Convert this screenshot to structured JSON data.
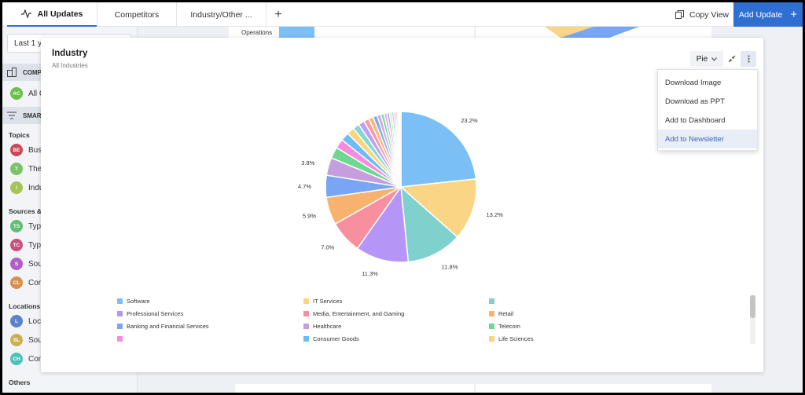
{
  "tabs": [
    {
      "label": "All Updates",
      "active": true
    },
    {
      "label": "Competitors",
      "active": false
    },
    {
      "label": "Industry/Other ...",
      "active": false
    }
  ],
  "toolbar": {
    "copy_view": "Copy View",
    "add_update": "Add Update"
  },
  "sidebar": {
    "date_range": "Last 1 y",
    "sections": [
      {
        "label": "COMPA"
      },
      {
        "label": "SMART"
      }
    ],
    "all_item": {
      "initials": "AC",
      "label": "All C",
      "color": "#6bbf4e"
    },
    "groups": [
      {
        "heading": "Topics",
        "items": [
          {
            "initials": "BE",
            "label": "Bus",
            "color": "#c94a55"
          },
          {
            "initials": "T",
            "label": "The",
            "color": "#7cc26a"
          },
          {
            "initials": "I",
            "label": "Indu",
            "color": "#a4c555"
          }
        ]
      },
      {
        "heading": "Sources &",
        "items": [
          {
            "initials": "TS",
            "label": "Type",
            "color": "#5fbf75"
          },
          {
            "initials": "TC",
            "label": "Type",
            "color": "#c8507a"
          },
          {
            "initials": "S",
            "label": "Sou",
            "color": "#b05fc4"
          },
          {
            "initials": "CL",
            "label": "Con",
            "color": "#d98f4e"
          }
        ]
      },
      {
        "heading": "Locations",
        "items": [
          {
            "initials": "L",
            "label": "Loca",
            "color": "#5c82cc"
          },
          {
            "initials": "SL",
            "label": "Sou",
            "color": "#c9b152"
          },
          {
            "initials": "CH",
            "label": "Con",
            "color": "#4fc0b6"
          }
        ]
      },
      {
        "heading": "Others",
        "items": []
      }
    ]
  },
  "background": {
    "row_label": "Operations"
  },
  "modal": {
    "title": "Industry",
    "subtitle": "All Industries",
    "chart_type_select": "Pie",
    "menu": [
      "Download Image",
      "Download as PPT",
      "Add to Dashboard",
      "Add to Newsletter"
    ],
    "hovered_menu_index": 3
  },
  "chart_data": {
    "type": "pie",
    "title": "Industry",
    "subtitle": "All Industries",
    "slices": [
      {
        "name": "Software",
        "value": 23.2,
        "label": "23.2%",
        "color": "#7bbff7"
      },
      {
        "name": "IT Services",
        "value": 13.2,
        "label": "13.2%",
        "color": "#fad585"
      },
      {
        "name": "",
        "value": 11.8,
        "label": "11.8%",
        "color": "#7fd1cd"
      },
      {
        "name": "Professional Services",
        "value": 11.3,
        "label": "11.3%",
        "color": "#b596f7"
      },
      {
        "name": "Media, Entertainment, and Gaming",
        "value": 7.0,
        "label": "7.0%",
        "color": "#f88f9e"
      },
      {
        "name": "Retail",
        "value": 5.9,
        "label": "5.9%",
        "color": "#f7b26f"
      },
      {
        "name": "Banking and Financial Services",
        "value": 4.7,
        "label": "4.7%",
        "color": "#78a6f4"
      },
      {
        "name": "Healthcare",
        "value": 3.8,
        "label": "3.8%",
        "color": "#c69ee0"
      },
      {
        "name": "Telecom",
        "value": 2.4,
        "label": "",
        "color": "#6ed88f"
      },
      {
        "name": "",
        "value": 2.0,
        "label": "",
        "color": "#f78be0"
      },
      {
        "name": "Consumer Goods",
        "value": 1.8,
        "label": "",
        "color": "#6cbdf6"
      },
      {
        "name": "Life Sciences",
        "value": 1.6,
        "label": "",
        "color": "#fbd480"
      },
      {
        "name": "",
        "value": 1.4,
        "label": "",
        "color": "#86d6d2"
      },
      {
        "name": "",
        "value": 1.3,
        "label": "",
        "color": "#bba0f4"
      },
      {
        "name": "",
        "value": 1.1,
        "label": "",
        "color": "#f59aa8"
      },
      {
        "name": "",
        "value": 1.0,
        "label": "",
        "color": "#f7b87a"
      },
      {
        "name": "",
        "value": 0.9,
        "label": "",
        "color": "#86aaf0"
      },
      {
        "name": "",
        "value": 0.8,
        "label": "",
        "color": "#cda6e6"
      },
      {
        "name": "",
        "value": 0.7,
        "label": "",
        "color": "#7ddd9d"
      },
      {
        "name": "",
        "value": 0.6,
        "label": "",
        "color": "#f39ee2"
      },
      {
        "name": "",
        "value": 0.55,
        "label": "",
        "color": "#80c4f4"
      },
      {
        "name": "",
        "value": 0.5,
        "label": "",
        "color": "#f8d78f"
      },
      {
        "name": "",
        "value": 0.45,
        "label": "",
        "color": "#8fd9d5"
      },
      {
        "name": "",
        "value": 0.4,
        "label": "",
        "color": "#c0a8f2"
      },
      {
        "name": "",
        "value": 0.35,
        "label": "",
        "color": "#f5a3b0"
      },
      {
        "name": "",
        "value": 0.3,
        "label": "",
        "color": "#f6bd85"
      },
      {
        "name": "",
        "value": 0.25,
        "label": "",
        "color": "#92b0ee"
      },
      {
        "name": "",
        "value": 0.2,
        "label": "",
        "color": "#d3aee8"
      }
    ],
    "legend": [
      {
        "name": "Software",
        "color": "#7bbff7"
      },
      {
        "name": "IT Services",
        "color": "#fad585"
      },
      {
        "name": "",
        "color": "#7fd1cd"
      },
      {
        "name": "Professional Services",
        "color": "#b596f7"
      },
      {
        "name": "Media, Entertainment, and Gaming",
        "color": "#f88f9e"
      },
      {
        "name": "Retail",
        "color": "#f7b26f"
      },
      {
        "name": "Banking and Financial Services",
        "color": "#78a6f4"
      },
      {
        "name": "Healthcare",
        "color": "#c69ee0"
      },
      {
        "name": "Telecom",
        "color": "#6ed88f"
      },
      {
        "name": "",
        "color": "#f78be0"
      },
      {
        "name": "Consumer Goods",
        "color": "#6cbdf6"
      },
      {
        "name": "Life Sciences",
        "color": "#fbd480"
      }
    ],
    "legend_placement": "bottom"
  }
}
